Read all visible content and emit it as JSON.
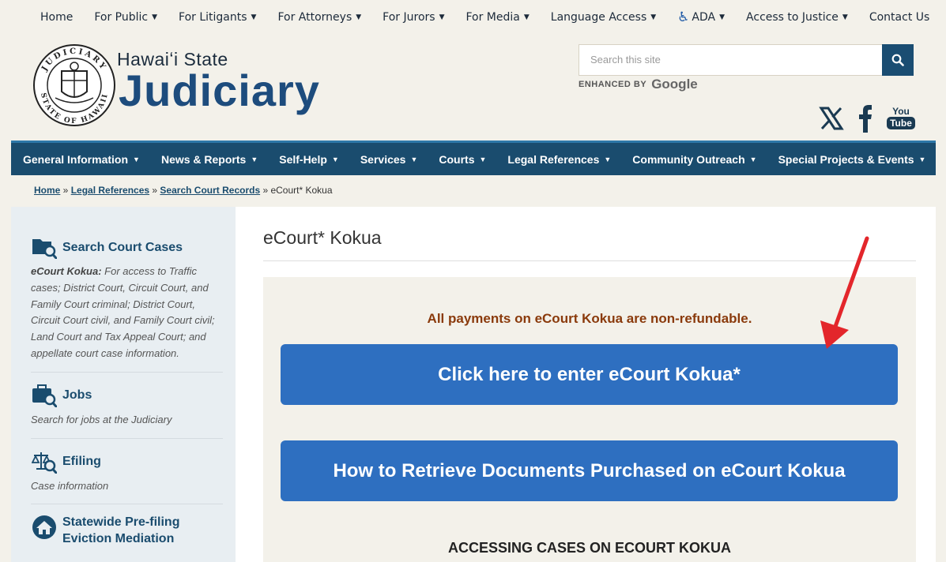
{
  "top_nav": [
    {
      "label": "Home",
      "caret": false
    },
    {
      "label": "For Public",
      "caret": true
    },
    {
      "label": "For Litigants",
      "caret": true
    },
    {
      "label": "For Attorneys",
      "caret": true
    },
    {
      "label": "For Jurors",
      "caret": true
    },
    {
      "label": "For Media",
      "caret": true
    },
    {
      "label": "Language Access",
      "caret": true
    },
    {
      "label": "ADA",
      "caret": true
    },
    {
      "label": "Access to Justice",
      "caret": true
    },
    {
      "label": "Contact Us",
      "caret": false
    }
  ],
  "brand": {
    "line1": "Hawaiʻi State",
    "line2": "Judiciary",
    "seal_text_top": "JUDICIARY",
    "seal_text_bottom": "STATE OF HAWAII"
  },
  "search": {
    "placeholder": "Search this site",
    "enhanced_label": "ENHANCED BY",
    "google_label": "Google"
  },
  "social": [
    "x-icon",
    "facebook-icon",
    "youtube-icon"
  ],
  "youtube_text": {
    "line1": "You",
    "line2": "Tube"
  },
  "main_nav": [
    {
      "label": "General Information"
    },
    {
      "label": "News & Reports"
    },
    {
      "label": "Self-Help"
    },
    {
      "label": "Services"
    },
    {
      "label": "Courts"
    },
    {
      "label": "Legal References"
    },
    {
      "label": "Community Outreach"
    },
    {
      "label": "Special Projects & Events"
    }
  ],
  "breadcrumb": {
    "home": "Home",
    "sep": " » ",
    "legal": "Legal References",
    "search": "Search Court Records",
    "current": "eCourt* Kokua"
  },
  "sidebar": {
    "search_cases": {
      "title": "Search Court Cases",
      "desc_bold": "eCourt Kokua:",
      "desc": " For access to Traffic cases; District Court, Circuit Court, and Family Court criminal; District Court, Circuit Court civil, and Family Court civil; Land Court and Tax Appeal Court; and appellate court case information."
    },
    "jobs": {
      "title": "Jobs",
      "desc": "Search for jobs at the Judiciary"
    },
    "efiling": {
      "title": "Efiling",
      "desc": "Case information"
    },
    "eviction": {
      "title": "Statewide Pre-filing Eviction Mediation"
    }
  },
  "main": {
    "title": "eCourt* Kokua",
    "notice": "All payments on eCourt Kokua are non-refundable.",
    "cta_enter": "Click here to enter eCourt Kokua*",
    "cta_retrieve": "How to Retrieve Documents Purchased on eCourt Kokua",
    "subhead": "ACCESSING CASES ON ECOURT KOKUA"
  },
  "colors": {
    "nav_bg": "#1a4c6e",
    "cta_bg": "#2e6fc0",
    "notice": "#8a3a0c",
    "arrow": "#e3262b"
  }
}
